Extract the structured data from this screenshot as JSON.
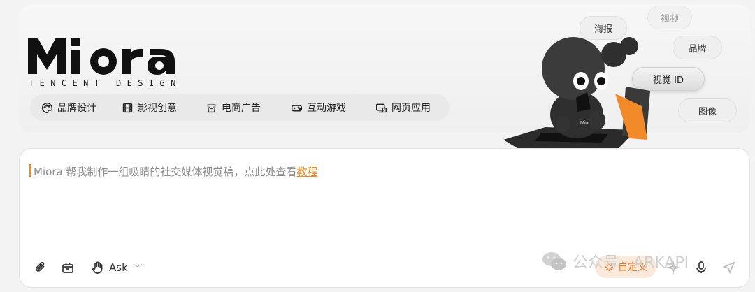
{
  "brand": {
    "logo_text": "Miora",
    "subtitle": "TENCENT DESIGN"
  },
  "categories": [
    {
      "label": "品牌设计",
      "icon": "palette-icon"
    },
    {
      "label": "影视创意",
      "icon": "film-icon"
    },
    {
      "label": "电商广告",
      "icon": "shopping-bag-icon"
    },
    {
      "label": "互动游戏",
      "icon": "gamepad-icon"
    },
    {
      "label": "网页应用",
      "icon": "web-app-icon"
    }
  ],
  "quick_tags": {
    "poster": "海报",
    "video": "视频",
    "brand": "品牌",
    "visual_id": "视觉 ID",
    "image": "图像"
  },
  "prompt": {
    "placeholder": "Miora 帮我制作一组吸睛的社交媒体视觉稿，点此处查看",
    "tutorial_link": "教程"
  },
  "toolbar": {
    "ask_label": "Ask",
    "custom_label": "自定义"
  },
  "watermark": {
    "text": "公众号 · ARKAPI"
  },
  "colors": {
    "accent": "#f08a24",
    "accent_bg": "#fbe9dc"
  }
}
